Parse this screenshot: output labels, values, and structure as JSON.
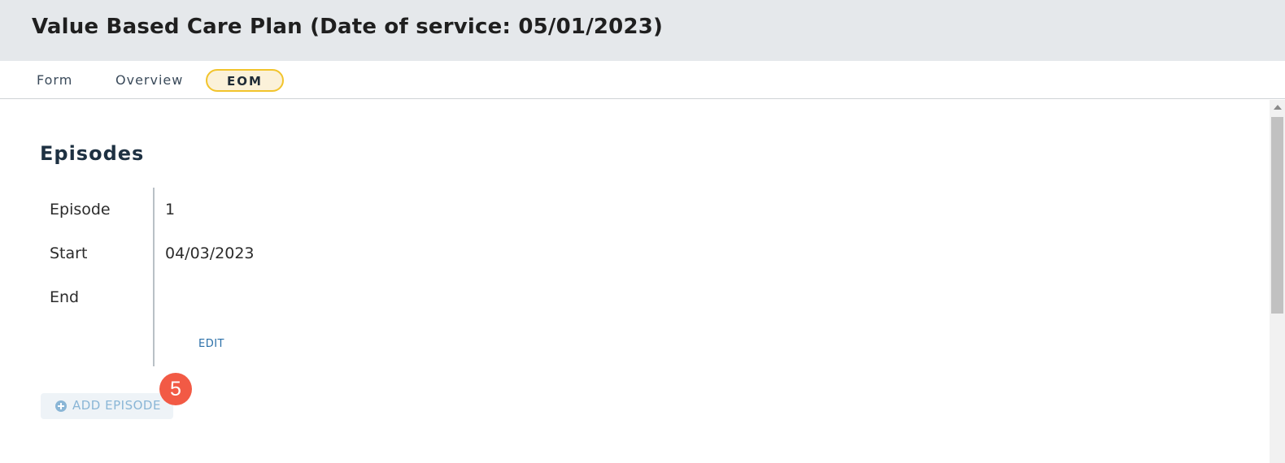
{
  "header": {
    "title": "Value Based Care Plan (Date of service: 05/01/2023)"
  },
  "tabs": [
    {
      "label": "Form",
      "active": false
    },
    {
      "label": "Overview",
      "active": false
    },
    {
      "label": "EOM",
      "active": true
    }
  ],
  "section": {
    "title": "Episodes"
  },
  "episode": {
    "fields": [
      {
        "label": "Episode",
        "value": "1"
      },
      {
        "label": "Start",
        "value": "04/03/2023"
      },
      {
        "label": "End",
        "value": ""
      }
    ],
    "edit_label": "EDIT"
  },
  "add_episode": {
    "label": "ADD EPISODE",
    "icon": "plus-circle-icon"
  },
  "step_badge": {
    "value": "5"
  },
  "colors": {
    "header_bg": "#e5e8eb",
    "active_tab_border": "#f2c42c",
    "active_tab_bg": "#fbf1d9",
    "link": "#2a6fa8",
    "badge": "#f25a45",
    "add_button_text": "#8ab6d6"
  }
}
